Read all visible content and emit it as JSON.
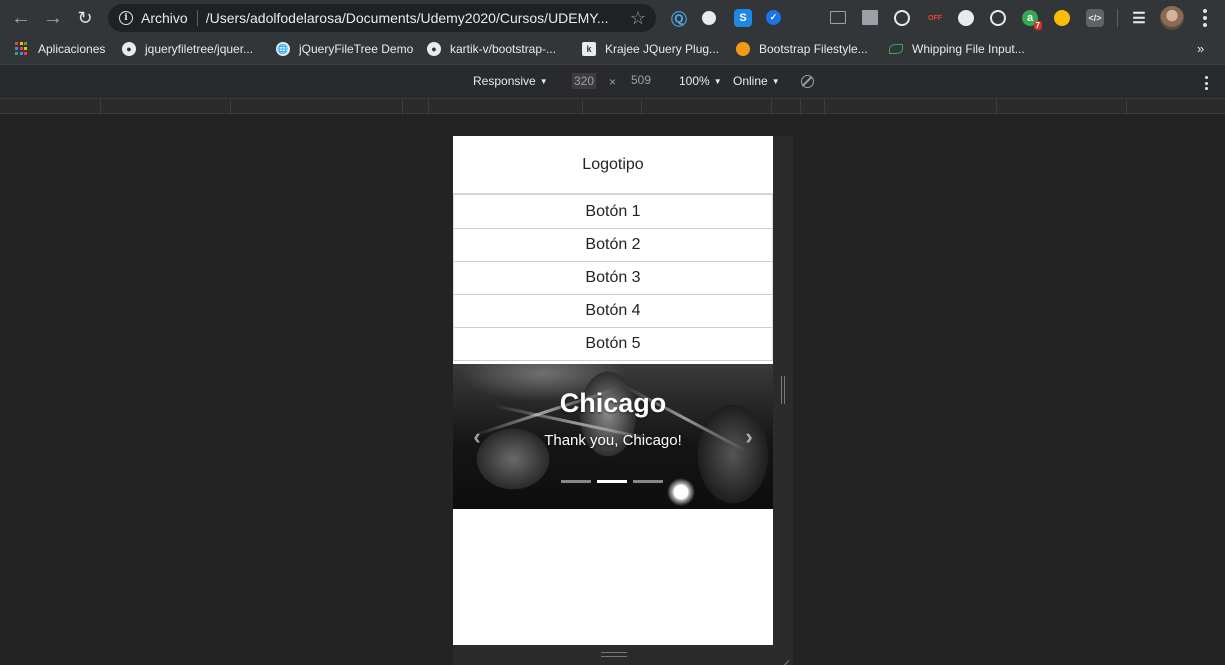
{
  "browser": {
    "omnibox": {
      "security_label": "Archivo",
      "url": "/Users/adolfodelarosa/Documents/Udemy2020/Cursos/UDEMY..."
    },
    "extensions": [
      {
        "name": "extension-c-icon",
        "color": "#4aa3df"
      },
      {
        "name": "extension-search-icon",
        "color": "#e8eaed"
      },
      {
        "name": "extension-s-icon",
        "color": "#1e88e5"
      },
      {
        "name": "extension-check-icon",
        "color": "#1a73e8"
      },
      {
        "name": "extension-terminal-icon",
        "color": "#9aa0a6"
      },
      {
        "name": "extension-grid-icon",
        "color": "#9aa0a6"
      },
      {
        "name": "extension-circle-icon",
        "color": "#e8eaed"
      },
      {
        "name": "extension-off-icon",
        "color": "#ea4335"
      },
      {
        "name": "extension-refresh-icon",
        "color": "#e8eaed"
      },
      {
        "name": "extension-target-icon",
        "color": "#e8eaed"
      },
      {
        "name": "extension-a-icon",
        "color": "#34a853",
        "badge": "7"
      },
      {
        "name": "extension-magnifier-icon",
        "color": "#fbbc04"
      },
      {
        "name": "extension-code-icon",
        "color": "#9aa0a6"
      }
    ]
  },
  "bookmarks": [
    {
      "label": "Aplicaciones",
      "icon": "apps-grid-icon"
    },
    {
      "label": "jqueryfiletree/jquer...",
      "icon": "github-icon"
    },
    {
      "label": "jQueryFileTree Demo",
      "icon": "globe-icon"
    },
    {
      "label": "kartik-v/bootstrap-...",
      "icon": "github-icon"
    },
    {
      "label": "Krajee JQuery Plug...",
      "icon": "krajee-icon"
    },
    {
      "label": "Bootstrap Filestyle...",
      "icon": "filestyle-icon"
    },
    {
      "label": "Whipping File Input...",
      "icon": "leaf-icon"
    }
  ],
  "devtools": {
    "device": "Responsive",
    "width": "320",
    "height": "509",
    "zoom": "100%",
    "network": "Online"
  },
  "page": {
    "logo": "Logotipo",
    "buttons": [
      "Botón 1",
      "Botón 2",
      "Botón 3",
      "Botón 4",
      "Botón 5"
    ],
    "carousel": {
      "title": "Chicago",
      "subtitle": "Thank you, Chicago!",
      "slide_count": 3,
      "active_index": 1
    }
  }
}
